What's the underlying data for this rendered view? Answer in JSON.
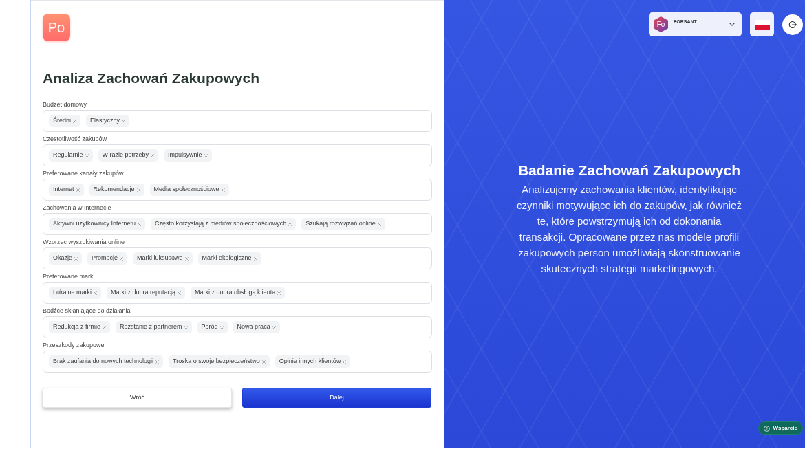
{
  "logo": {
    "text": "Po"
  },
  "form": {
    "title": "Analiza Zachowań Zakupowych",
    "fields": [
      {
        "label": "Budżet domowy",
        "tags": [
          "Średni",
          "Elastyczny"
        ]
      },
      {
        "label": "Częstotliwość zakupów",
        "tags": [
          "Regularnie",
          "W razie potrzeby",
          "Impulsywnie"
        ]
      },
      {
        "label": "Preferowane kanały zakupów",
        "tags": [
          "Internet",
          "Rekomendacje",
          "Media społecznościowe"
        ]
      },
      {
        "label": "Zachowania w Internecie",
        "tags": [
          "Aktywni użytkownicy Internetu",
          "Często korzystają z mediów społecznościowych",
          "Szukają rozwiązań online"
        ]
      },
      {
        "label": "Wzorzec wyszukiwania online",
        "tags": [
          "Okazje",
          "Promocje",
          "Marki luksusowe",
          "Marki ekologiczne"
        ]
      },
      {
        "label": "Preferowane marki",
        "tags": [
          "Lokalne marki",
          "Marki z dobra reputacją",
          "Marki z dobra obsługą klienta"
        ]
      },
      {
        "label": "Bodźce skłaniające do działania",
        "tags": [
          "Redukcja z firmie",
          "Rozstanie z partnerem",
          "Poród",
          "Nowa praca"
        ]
      },
      {
        "label": "Przeszkody zakupowe",
        "tags": [
          "Brak zaufania do nowych technologii",
          "Troska o swoje bezpieczeństwo",
          "Opinie innych klientów"
        ]
      }
    ],
    "buttons": [
      {
        "label": "Wróć",
        "kind": "secondary"
      },
      {
        "label": "Dalej",
        "kind": "primary"
      }
    ]
  },
  "header": {
    "account": {
      "logo_text": "Fo",
      "name": "FORSANT"
    }
  },
  "info": {
    "title": "Badanie Zachowań Zakupowych",
    "text": "Analizujemy zachowania klientów, identyfikując czynniki motywujące ich do zakupów, jak również te, które powstrzymują ich od dokonania transakcji. Opracowane przez nas modele profili zakupowych person umożliwiają skonstruowanie skutecznych strategii marketingowych."
  },
  "support_button": {
    "label": "Wsparcie"
  }
}
